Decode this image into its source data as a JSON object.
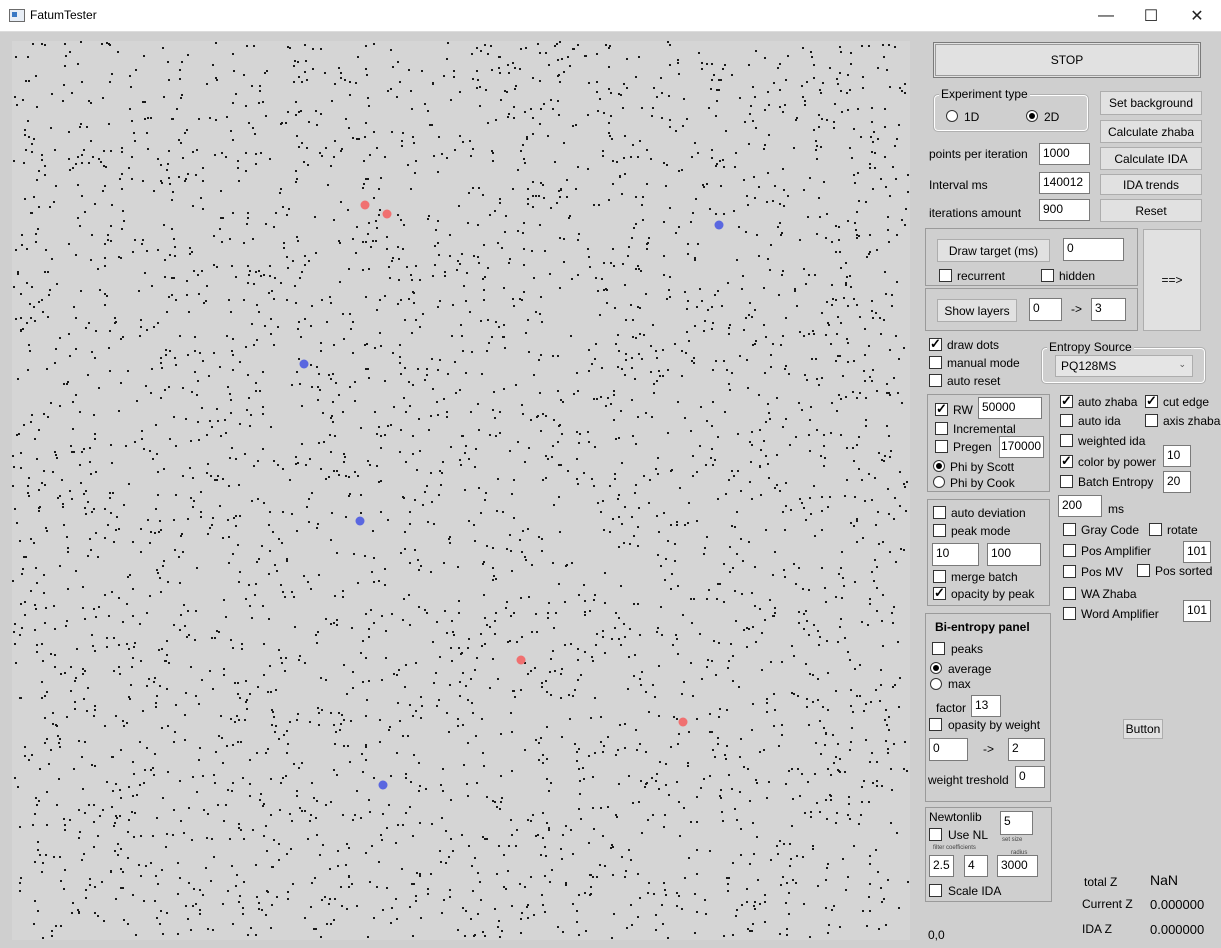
{
  "window": {
    "title": "FatumTester",
    "minimize_icon": "minimize-icon",
    "maximize_icon": "maximize-icon",
    "close_icon": "close-icon"
  },
  "colors": {
    "background": "#cfcfcf",
    "canvas": "#d5d5d5",
    "dot": "#1a1a1a",
    "red_point": "#f07070",
    "blue_point": "#5a67e0"
  },
  "controls": {
    "stop_label": "STOP",
    "experiment_type": {
      "title": "Experiment type",
      "options": [
        "1D",
        "2D"
      ],
      "selected": "2D"
    },
    "set_background": "Set background",
    "calculate_zhaba": "Calculate zhaba",
    "calculate_ida": "Calculate IDA",
    "ida_trends": "IDA trends",
    "reset": "Reset",
    "points_per_iteration": {
      "label": "points per iteration",
      "value": "1000"
    },
    "interval_ms": {
      "label": "Interval ms",
      "value": "140012"
    },
    "iterations_amount": {
      "label": "iterations amount",
      "value": "900"
    },
    "draw_target": {
      "label": "Draw target (ms)",
      "value": "0",
      "recurrent": "recurrent",
      "hidden": "hidden"
    },
    "arrow_button": "==>",
    "show_layers": {
      "label": "Show layers",
      "from": "0",
      "arrow": "->",
      "to": "3"
    },
    "draw_dots": "draw dots",
    "manual_mode": "manual mode",
    "auto_reset": "auto reset",
    "entropy_source": {
      "title": "Entropy Source",
      "value": "PQ128MS"
    },
    "rw": {
      "label": "RW",
      "value": "50000"
    },
    "incremental": "Incremental",
    "pregen": {
      "label": "Pregen",
      "value": "170000"
    },
    "phi_scott": "Phi by Scott",
    "phi_cook": "Phi by Cook",
    "auto_deviation": "auto deviation",
    "peak_mode": "peak mode",
    "peak_a": "10",
    "peak_b": "100",
    "merge_batch": "merge batch",
    "opacity_by_peak": "opacity by peak",
    "bi_entropy": {
      "title": "Bi-entropy panel",
      "peaks": "peaks",
      "average": "average",
      "max": "max",
      "factor_label": "factor",
      "factor_value": "13",
      "opasity_by_weight": "opasity by weight",
      "range_from": "0",
      "arrow": "->",
      "range_to": "2",
      "weight_treshold_label": "weight treshold",
      "weight_treshold_value": "0"
    },
    "newtonlib": {
      "title": "Newtonlib",
      "set_size": "5",
      "set_size_label": "set size",
      "use_nl": "Use NL",
      "filter_label": "filter coefficients",
      "radius_label": "radius",
      "coef_a": "2.5",
      "coef_b": "4",
      "radius": "3000",
      "scale_ida": "Scale IDA"
    },
    "auto_zhaba": "auto zhaba",
    "cut_edge": "cut edge",
    "auto_ida": "auto ida",
    "axis_zhaba": "axis zhaba",
    "weighted_ida": "weighted ida",
    "color_by_power": {
      "label": "color by power",
      "value": "10"
    },
    "batch_entropy": {
      "label": "Batch Entropy",
      "value": "20"
    },
    "ms_value": "200",
    "ms_label": "ms",
    "gray_code": "Gray Code",
    "rotate": "rotate",
    "pos_amplifier": {
      "label": "Pos Amplifier",
      "value": "101"
    },
    "pos_mv": "Pos MV",
    "pos_sorted": "Pos sorted",
    "wa_zhaba": "WA Zhaba",
    "word_amplifier": {
      "label": "Word Amplifier",
      "value": "101"
    },
    "button": "Button",
    "coords": "0,0",
    "total_z": {
      "label": "total Z",
      "value": "NaN"
    },
    "current_z": {
      "label": "Current Z",
      "value": "0.000000"
    },
    "ida_z": {
      "label": "IDA Z",
      "value": "0.000000"
    }
  }
}
